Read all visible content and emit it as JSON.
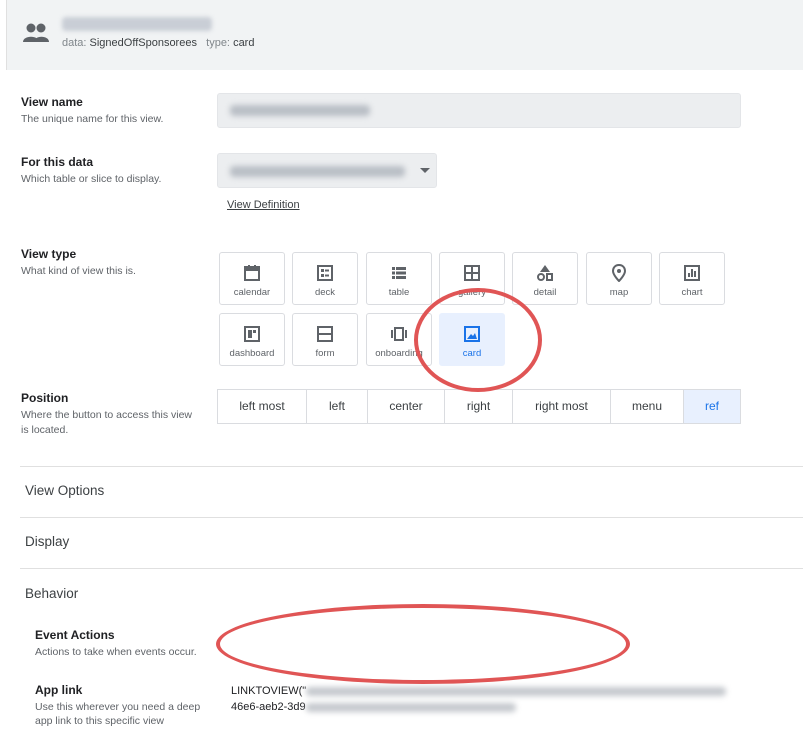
{
  "header": {
    "icon": "people-icon",
    "meta_data_key": "data:",
    "meta_data_value": "SignedOffSponsorees",
    "meta_type_key": "type:",
    "meta_type_value": "card"
  },
  "form": {
    "view_name": {
      "title": "View name",
      "subtitle": "The unique name for this view."
    },
    "for_this_data": {
      "title": "For this data",
      "subtitle": "Which table or slice to display.",
      "link": "View Definition"
    },
    "view_type": {
      "title": "View type",
      "subtitle": "What kind of view this is.",
      "options": [
        {
          "label": "calendar",
          "icon": "calendar-icon"
        },
        {
          "label": "deck",
          "icon": "deck-icon"
        },
        {
          "label": "table",
          "icon": "table-icon"
        },
        {
          "label": "gallery",
          "icon": "gallery-icon"
        },
        {
          "label": "detail",
          "icon": "detail-icon"
        },
        {
          "label": "map",
          "icon": "map-pin-icon"
        },
        {
          "label": "chart",
          "icon": "chart-icon"
        },
        {
          "label": "dashboard",
          "icon": "dashboard-icon"
        },
        {
          "label": "form",
          "icon": "form-icon"
        },
        {
          "label": "onboarding",
          "icon": "onboarding-icon"
        },
        {
          "label": "card",
          "icon": "image-icon"
        }
      ],
      "selected": "card"
    },
    "position": {
      "title": "Position",
      "subtitle": "Where the button to access this view is located.",
      "options": [
        "left most",
        "left",
        "center",
        "right",
        "right most",
        "menu",
        "ref"
      ],
      "selected": "ref"
    }
  },
  "sections": {
    "view_options": "View Options",
    "display": "Display",
    "behavior": "Behavior"
  },
  "behavior": {
    "event_actions": {
      "title": "Event Actions",
      "subtitle": "Actions to take when events occur."
    },
    "app_link": {
      "title": "App link",
      "subtitle": "Use this wherever you need a deep app link to this specific view",
      "value_line1_prefix": "LINKTOVIEW(\"",
      "value_line2_prefix": "46e6-aeb2-3d9"
    }
  },
  "colors": {
    "accent": "#1a73e8",
    "annotation": "#e05555",
    "selected_bg": "#e8f0fe"
  }
}
